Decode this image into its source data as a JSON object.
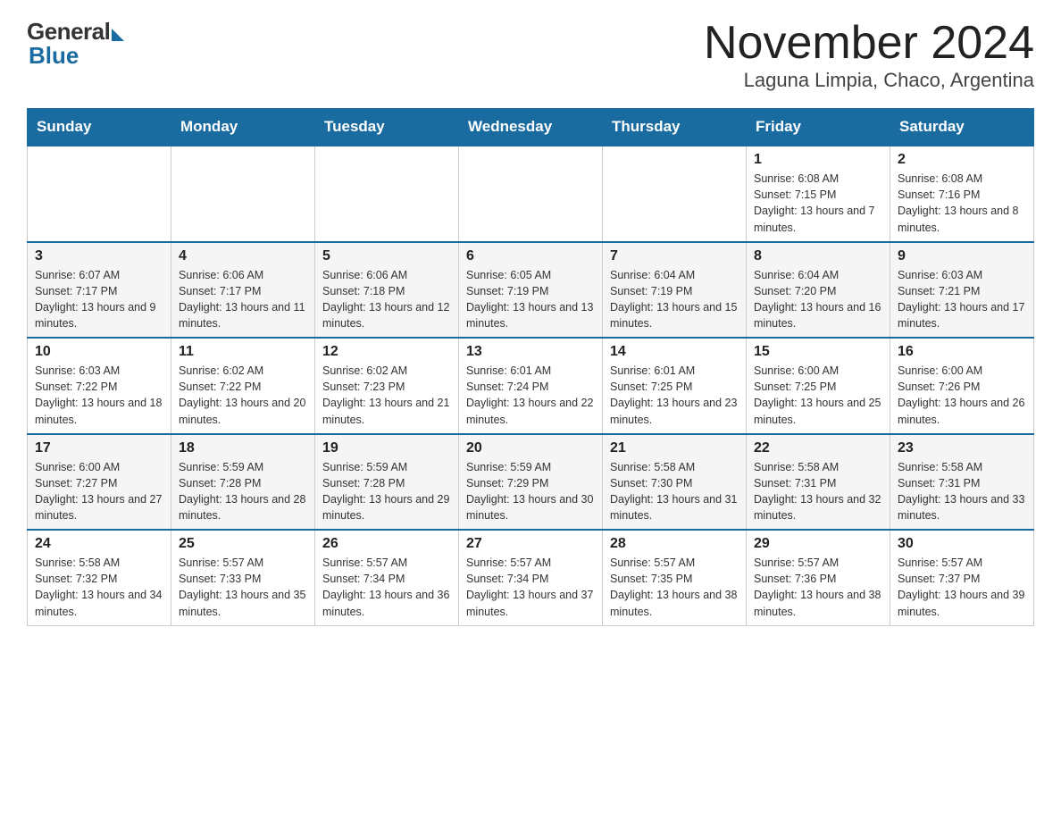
{
  "header": {
    "logo_general": "General",
    "logo_blue": "Blue",
    "title": "November 2024",
    "subtitle": "Laguna Limpia, Chaco, Argentina"
  },
  "days_of_week": [
    "Sunday",
    "Monday",
    "Tuesday",
    "Wednesday",
    "Thursday",
    "Friday",
    "Saturday"
  ],
  "weeks": [
    [
      {
        "day": "",
        "info": ""
      },
      {
        "day": "",
        "info": ""
      },
      {
        "day": "",
        "info": ""
      },
      {
        "day": "",
        "info": ""
      },
      {
        "day": "",
        "info": ""
      },
      {
        "day": "1",
        "info": "Sunrise: 6:08 AM\nSunset: 7:15 PM\nDaylight: 13 hours and 7 minutes."
      },
      {
        "day": "2",
        "info": "Sunrise: 6:08 AM\nSunset: 7:16 PM\nDaylight: 13 hours and 8 minutes."
      }
    ],
    [
      {
        "day": "3",
        "info": "Sunrise: 6:07 AM\nSunset: 7:17 PM\nDaylight: 13 hours and 9 minutes."
      },
      {
        "day": "4",
        "info": "Sunrise: 6:06 AM\nSunset: 7:17 PM\nDaylight: 13 hours and 11 minutes."
      },
      {
        "day": "5",
        "info": "Sunrise: 6:06 AM\nSunset: 7:18 PM\nDaylight: 13 hours and 12 minutes."
      },
      {
        "day": "6",
        "info": "Sunrise: 6:05 AM\nSunset: 7:19 PM\nDaylight: 13 hours and 13 minutes."
      },
      {
        "day": "7",
        "info": "Sunrise: 6:04 AM\nSunset: 7:19 PM\nDaylight: 13 hours and 15 minutes."
      },
      {
        "day": "8",
        "info": "Sunrise: 6:04 AM\nSunset: 7:20 PM\nDaylight: 13 hours and 16 minutes."
      },
      {
        "day": "9",
        "info": "Sunrise: 6:03 AM\nSunset: 7:21 PM\nDaylight: 13 hours and 17 minutes."
      }
    ],
    [
      {
        "day": "10",
        "info": "Sunrise: 6:03 AM\nSunset: 7:22 PM\nDaylight: 13 hours and 18 minutes."
      },
      {
        "day": "11",
        "info": "Sunrise: 6:02 AM\nSunset: 7:22 PM\nDaylight: 13 hours and 20 minutes."
      },
      {
        "day": "12",
        "info": "Sunrise: 6:02 AM\nSunset: 7:23 PM\nDaylight: 13 hours and 21 minutes."
      },
      {
        "day": "13",
        "info": "Sunrise: 6:01 AM\nSunset: 7:24 PM\nDaylight: 13 hours and 22 minutes."
      },
      {
        "day": "14",
        "info": "Sunrise: 6:01 AM\nSunset: 7:25 PM\nDaylight: 13 hours and 23 minutes."
      },
      {
        "day": "15",
        "info": "Sunrise: 6:00 AM\nSunset: 7:25 PM\nDaylight: 13 hours and 25 minutes."
      },
      {
        "day": "16",
        "info": "Sunrise: 6:00 AM\nSunset: 7:26 PM\nDaylight: 13 hours and 26 minutes."
      }
    ],
    [
      {
        "day": "17",
        "info": "Sunrise: 6:00 AM\nSunset: 7:27 PM\nDaylight: 13 hours and 27 minutes."
      },
      {
        "day": "18",
        "info": "Sunrise: 5:59 AM\nSunset: 7:28 PM\nDaylight: 13 hours and 28 minutes."
      },
      {
        "day": "19",
        "info": "Sunrise: 5:59 AM\nSunset: 7:28 PM\nDaylight: 13 hours and 29 minutes."
      },
      {
        "day": "20",
        "info": "Sunrise: 5:59 AM\nSunset: 7:29 PM\nDaylight: 13 hours and 30 minutes."
      },
      {
        "day": "21",
        "info": "Sunrise: 5:58 AM\nSunset: 7:30 PM\nDaylight: 13 hours and 31 minutes."
      },
      {
        "day": "22",
        "info": "Sunrise: 5:58 AM\nSunset: 7:31 PM\nDaylight: 13 hours and 32 minutes."
      },
      {
        "day": "23",
        "info": "Sunrise: 5:58 AM\nSunset: 7:31 PM\nDaylight: 13 hours and 33 minutes."
      }
    ],
    [
      {
        "day": "24",
        "info": "Sunrise: 5:58 AM\nSunset: 7:32 PM\nDaylight: 13 hours and 34 minutes."
      },
      {
        "day": "25",
        "info": "Sunrise: 5:57 AM\nSunset: 7:33 PM\nDaylight: 13 hours and 35 minutes."
      },
      {
        "day": "26",
        "info": "Sunrise: 5:57 AM\nSunset: 7:34 PM\nDaylight: 13 hours and 36 minutes."
      },
      {
        "day": "27",
        "info": "Sunrise: 5:57 AM\nSunset: 7:34 PM\nDaylight: 13 hours and 37 minutes."
      },
      {
        "day": "28",
        "info": "Sunrise: 5:57 AM\nSunset: 7:35 PM\nDaylight: 13 hours and 38 minutes."
      },
      {
        "day": "29",
        "info": "Sunrise: 5:57 AM\nSunset: 7:36 PM\nDaylight: 13 hours and 38 minutes."
      },
      {
        "day": "30",
        "info": "Sunrise: 5:57 AM\nSunset: 7:37 PM\nDaylight: 13 hours and 39 minutes."
      }
    ]
  ]
}
